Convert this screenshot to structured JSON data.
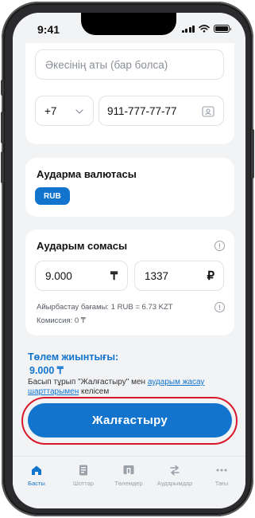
{
  "status_bar": {
    "time": "9:41"
  },
  "form": {
    "patronymic_placeholder": "Әкесінің аты (бар болса)",
    "country_code": "+7",
    "phone_value": "911-777-77-77"
  },
  "currency": {
    "title": "Аударма валютасы",
    "selected": "RUB"
  },
  "amount": {
    "title": "Аударым сомасы",
    "kzt_value": "9.000",
    "kzt_symbol": "₸",
    "rub_value": "1337",
    "rub_symbol": "₽",
    "rate_text": "Айырбастау бағамы: 1 RUB = 6.73 KZT",
    "commission_text": "Комиссия: 0 ₸"
  },
  "summary": {
    "title": "Төлем жиынтығы:",
    "total": "9.000 ₸",
    "terms_prefix": "Басып тұрып \"Жалғастыру\" мен ",
    "terms_link": "аударым жасау шарттарымен",
    "terms_suffix": " келісем"
  },
  "cta": {
    "label": "Жалғастыру"
  },
  "tabs": [
    {
      "label": "Басты",
      "icon": "home-icon",
      "active": true
    },
    {
      "label": "Шоттар",
      "icon": "accounts-icon",
      "active": false
    },
    {
      "label": "Төлемдер",
      "icon": "payments-icon",
      "active": false
    },
    {
      "label": "Аударымдар",
      "icon": "transfers-icon",
      "active": false
    },
    {
      "label": "Тағы",
      "icon": "more-icon",
      "active": false
    }
  ],
  "colors": {
    "accent": "#1274cc",
    "highlight": "#d8192d"
  }
}
